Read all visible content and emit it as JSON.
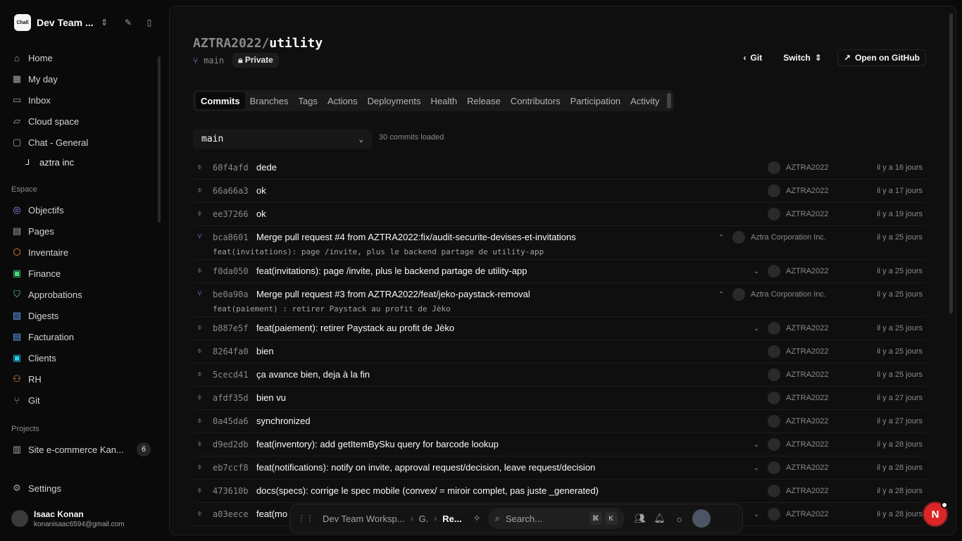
{
  "workspace": {
    "name": "Dev Team ...",
    "logo_text": "Chall"
  },
  "nav": [
    {
      "label": "Home",
      "icon": "home-icon"
    },
    {
      "label": "My day",
      "icon": "calendar-icon"
    },
    {
      "label": "Inbox",
      "icon": "inbox-icon"
    },
    {
      "label": "Cloud space",
      "icon": "folder-icon"
    },
    {
      "label": "Chat - General",
      "icon": "chat-icon"
    }
  ],
  "nav_sub": {
    "label": "aztra inc"
  },
  "espace_label": "Espace",
  "espace": [
    {
      "label": "Objectifs",
      "icon": "target-icon",
      "color": "#a78bfa"
    },
    {
      "label": "Pages",
      "icon": "file-icon",
      "color": "#a3a3a3"
    },
    {
      "label": "Inventaire",
      "icon": "box-icon",
      "color": "#fb923c"
    },
    {
      "label": "Finance",
      "icon": "wallet-icon",
      "color": "#4ade80"
    },
    {
      "label": "Approbations",
      "icon": "shield-check-icon",
      "color": "#4ade80"
    },
    {
      "label": "Digests",
      "icon": "digest-icon",
      "color": "#60a5fa"
    },
    {
      "label": "Facturation",
      "icon": "invoice-icon",
      "color": "#60a5fa"
    },
    {
      "label": "Clients",
      "icon": "clients-icon",
      "color": "#22d3ee"
    },
    {
      "label": "RH",
      "icon": "people-icon",
      "color": "#fb923c"
    },
    {
      "label": "Git",
      "icon": "git-branch-icon",
      "color": "#e879f9"
    }
  ],
  "projects_label": "Projects",
  "project": {
    "label": "Site e-commerce Kan...",
    "badge": "6"
  },
  "settings_label": "Settings",
  "user": {
    "name": "Isaac Konan",
    "email": "konanisaac6594@gmail.com"
  },
  "repo": {
    "owner": "AZTRA2022/",
    "name": "utility",
    "branch": "main",
    "visibility": "Private"
  },
  "actions": {
    "git": "Git",
    "switch": "Switch",
    "open": "Open on GitHub"
  },
  "tabs": [
    "Commits",
    "Branches",
    "Tags",
    "Actions",
    "Deployments",
    "Health",
    "Release",
    "Contributors",
    "Participation",
    "Activity"
  ],
  "branch_select": "main",
  "commits_count": "30 commits loaded",
  "commits": [
    {
      "sha": "60f4afd",
      "msg": "dede",
      "author": "AZTRA2022",
      "time": "il y a 16 jours",
      "merge": false,
      "exp": ""
    },
    {
      "sha": "66a66a3",
      "msg": "ok",
      "author": "AZTRA2022",
      "time": "il y a 17 jours",
      "merge": false,
      "exp": ""
    },
    {
      "sha": "ee37266",
      "msg": "ok",
      "author": "AZTRA2022",
      "time": "il y a 19 jours",
      "merge": false,
      "exp": ""
    },
    {
      "sha": "bca8601",
      "msg": "Merge pull request #4 from AZTRA2022:fix/audit-securite-devises-et-invitations",
      "desc": "feat(invitations): page /invite, plus le backend partage de utility-app",
      "author": "Aztra Corporation Inc.",
      "time": "il y a 25 jours",
      "merge": true,
      "exp": "^"
    },
    {
      "sha": "f0da050",
      "msg": "feat(invitations): page /invite, plus le backend partage de utility-app",
      "author": "AZTRA2022",
      "time": "il y a 25 jours",
      "merge": false,
      "exp": "v"
    },
    {
      "sha": "be0a90a",
      "msg": "Merge pull request #3 from AZTRA2022/feat/jeko-paystack-removal",
      "desc": "feat(paiement) : retirer Paystack au profit de Jèko",
      "author": "Aztra Corporation Inc.",
      "time": "il y a 25 jours",
      "merge": true,
      "exp": "^"
    },
    {
      "sha": "b887e5f",
      "msg": "feat(paiement): retirer Paystack au profit de Jèko",
      "author": "AZTRA2022",
      "time": "il y a 25 jours",
      "merge": false,
      "exp": "v"
    },
    {
      "sha": "8264fa0",
      "msg": "bien",
      "author": "AZTRA2022",
      "time": "il y a 25 jours",
      "merge": false,
      "exp": ""
    },
    {
      "sha": "5cecd41",
      "msg": "ça avance bien, deja à la fin",
      "author": "AZTRA2022",
      "time": "il y a 25 jours",
      "merge": false,
      "exp": ""
    },
    {
      "sha": "afdf35d",
      "msg": "bien vu",
      "author": "AZTRA2022",
      "time": "il y a 27 jours",
      "merge": false,
      "exp": ""
    },
    {
      "sha": "0a45da6",
      "msg": "synchronized",
      "author": "AZTRA2022",
      "time": "il y a 27 jours",
      "merge": false,
      "exp": ""
    },
    {
      "sha": "d9ed2db",
      "msg": "feat(inventory): add getItemBySku query for barcode lookup",
      "author": "AZTRA2022",
      "time": "il y a 28 jours",
      "merge": false,
      "exp": "v"
    },
    {
      "sha": "eb7ccf8",
      "msg": "feat(notifications): notify on invite, approval request/decision, leave request/decision",
      "author": "AZTRA2022",
      "time": "il y a 28 jours",
      "merge": false,
      "exp": "v"
    },
    {
      "sha": "473610b",
      "msg": "docs(specs): corrige le spec mobile (convex/ = miroir complet, pas juste _generated)",
      "author": "AZTRA2022",
      "time": "il y a 28 jours",
      "merge": false,
      "exp": ""
    },
    {
      "sha": "a03eece",
      "msg": "feat(mo",
      "author": "AZTRA2022",
      "time": "il y a 28 jours",
      "merge": false,
      "exp": "v"
    }
  ],
  "dock": {
    "crumb1": "Dev Team Worksp...",
    "crumb2": "G.",
    "crumb3": "Re...",
    "search_placeholder": "Search...",
    "kbd1": "⌘",
    "kbd2": "K"
  },
  "fab": {
    "letter": "N"
  }
}
